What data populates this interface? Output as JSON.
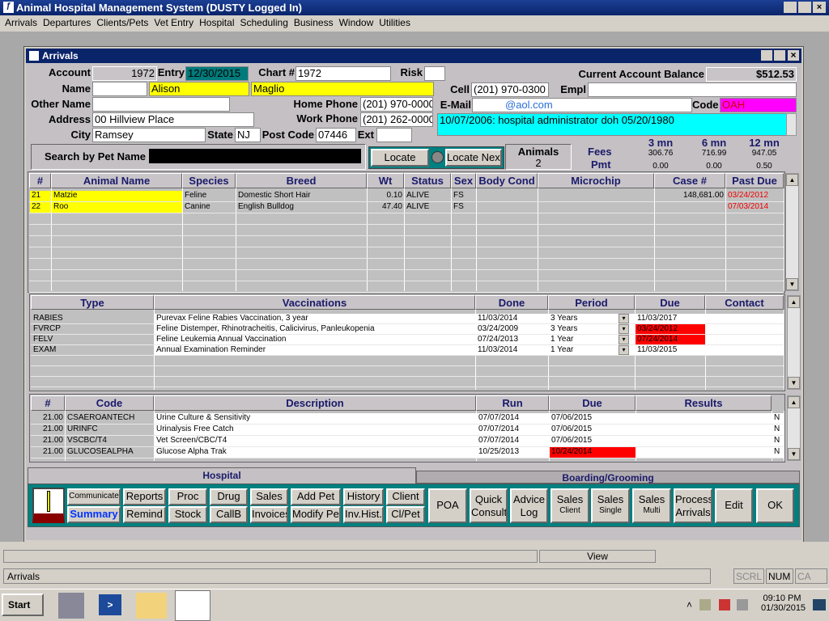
{
  "app": {
    "title": "Animal Hospital Management System (DUSTY Logged In)",
    "window_title": "Arrivals"
  },
  "menu": [
    "Arrivals",
    "Departures",
    "Clients/Pets",
    "Vet Entry",
    "Hospital",
    "Scheduling",
    "Business",
    "Window",
    "Utilities"
  ],
  "client": {
    "account_label": "Account",
    "account": "1972",
    "entry_label": "Entry",
    "entry": "12/30/2015",
    "chart_label": "Chart #",
    "chart": "1972",
    "risk_label": "Risk",
    "risk": "",
    "name_label": "Name",
    "first_name": "Alison",
    "last_name": "Maglio",
    "other_name_label": "Other Name",
    "other_name": "",
    "address_label": "Address",
    "address": "00 Hillview Place",
    "city_label": "City",
    "city": "Ramsey",
    "state_label": "State",
    "state": "NJ",
    "post_label": "Post Code",
    "post": "07446",
    "ext_label": "Ext",
    "ext": "",
    "home_label": "Home Phone",
    "home": "(201) 970-0000",
    "work_label": "Work Phone",
    "work": "(201) 262-0000",
    "cell_label": "Cell",
    "cell": "(201) 970-0300",
    "empl_label": "Empl",
    "empl": "",
    "email_label": "E-Mail",
    "email": "@aol.com",
    "code_label": "Code",
    "code": "OAH",
    "balance_label": "Current Account Balance",
    "balance": "$512.53",
    "note": "10/07/2006: hospital administrator  doh  05/20/1980"
  },
  "search": {
    "label": "Search by Pet Name",
    "value": "",
    "locate": "Locate",
    "locate_next": "Locate Next",
    "animals_label": "Animals",
    "animals": "2"
  },
  "fees": {
    "periods": [
      "3 mn",
      "6 mn",
      "12 mn"
    ],
    "fees_label": "Fees",
    "pmt_label": "Pmt",
    "fees": [
      "306.76",
      "716.99",
      "947.05"
    ],
    "pmt": [
      "0.00",
      "0.00",
      "0.50"
    ]
  },
  "pets": {
    "headers": [
      "#",
      "Animal Name",
      "Species",
      "Breed",
      "Wt",
      "Status",
      "Sex",
      "Body Cond",
      "Microchip",
      "Case #",
      "Past Due"
    ],
    "rows": [
      [
        "21",
        "Matzie",
        "Feline",
        "Domestic Short Hair",
        "0.10",
        "ALIVE",
        "FS",
        "",
        "",
        "148,681.00",
        "03/24/2012"
      ],
      [
        "22",
        "Roo",
        "Canine",
        "English Bulldog",
        "47.40",
        "ALIVE",
        "FS",
        "",
        "",
        "",
        "07/03/2014"
      ]
    ]
  },
  "vaccines": {
    "headers": [
      "Type",
      "Vaccinations",
      "Done",
      "Period",
      "Due",
      "Contact"
    ],
    "rows": [
      [
        "RABIES",
        "Purevax Feline Rabies Vaccination, 3 year",
        "11/03/2014",
        "3 Years",
        "11/03/2017",
        ""
      ],
      [
        "FVRCP",
        "Feline Distemper, Rhinotracheitis, Calicivirus, Panleukopenia",
        "03/24/2009",
        "3 Years",
        "03/24/2012",
        ""
      ],
      [
        "FELV",
        "Feline Leukemia Annual Vaccination",
        "07/24/2013",
        "1 Year",
        "07/24/2014",
        ""
      ],
      [
        "EXAM",
        "Annual Examination Reminder",
        "11/03/2014",
        "1 Year",
        "11/03/2015",
        ""
      ]
    ],
    "overdue": [
      false,
      true,
      true,
      false
    ]
  },
  "labs": {
    "headers": [
      "#",
      "Code",
      "Description",
      "Run",
      "Due",
      "Results"
    ],
    "rows": [
      [
        "21.00",
        "CSAEROANTECH",
        "Urine Culture & Sensitivity",
        "07/07/2014",
        "07/06/2015",
        "",
        "N"
      ],
      [
        "21.00",
        "URINFC",
        "Urinalysis Free Catch",
        "07/07/2014",
        "07/06/2015",
        "",
        "N"
      ],
      [
        "21.00",
        "VSCBC/T4",
        "Vet Screen/CBC/T4",
        "07/07/2014",
        "07/06/2015",
        "",
        "N"
      ],
      [
        "21.00",
        "GLUCOSEALPHA",
        "Glucose Alpha Trak",
        "10/25/2013",
        "10/24/2014",
        "",
        "N"
      ]
    ],
    "overdue": [
      false,
      false,
      false,
      true
    ]
  },
  "tabs": [
    "Hospital",
    "Boarding/Grooming"
  ],
  "buttons2": [
    [
      "Communicate",
      "Summary"
    ],
    [
      "Reports",
      "Remind"
    ],
    [
      "Proc",
      "Stock"
    ],
    [
      "Drug",
      "CallB"
    ],
    [
      "Sales",
      "Invoices"
    ],
    [
      "Add Pet",
      "Modify Pet"
    ],
    [
      "History",
      "Inv.Hist."
    ],
    [
      "Client",
      "Cl/Pet"
    ]
  ],
  "buttons1": [
    [
      "POA",
      ""
    ],
    [
      "Quick",
      "Consult"
    ],
    [
      "Advice",
      "Log"
    ],
    [
      "Sales",
      "Client"
    ],
    [
      "Sales",
      "Single"
    ],
    [
      "Sales",
      "Multi"
    ],
    [
      "Process",
      "Arrivals"
    ],
    [
      "Edit",
      ""
    ],
    [
      "OK",
      ""
    ]
  ],
  "status": {
    "view": "View",
    "left": "Arrivals",
    "scrl": "SCRL",
    "num": "NUM",
    "cap": "CA"
  },
  "taskbar": {
    "start": "Start",
    "time": "09:10 PM",
    "date": "01/30/2015"
  },
  "colors": {
    "title": "#0a246a",
    "teal": "#008080",
    "overdue": "#ff0000",
    "yellow": "#ffff00",
    "cyan": "#00ffff",
    "magenta": "#ff00ff"
  }
}
